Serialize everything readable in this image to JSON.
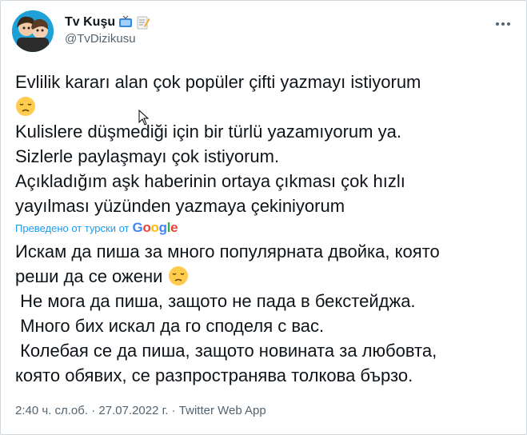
{
  "author": {
    "display_name": "Tv Kuşu",
    "handle": "@TvDizikusu"
  },
  "tweet": {
    "original_lines": [
      "Evlilik kararı alan çok popüler çifti yazmayı istiyorum",
      "Kulislere düşmediği için bir türlü yazamıyorum ya.",
      "Sizlerle paylaşmayı çok istiyorum.",
      "Açıkladığım aşk haberinin ortaya çıkması çok hızlı",
      "yayılması yüzünden yazmaya çekiniyorum"
    ],
    "translation_credit": "Преведено от турски от",
    "translation_provider": "Google",
    "translated_lines": [
      "Искам да пиша за много популярната двойка, която",
      "реши да се ожени",
      " Не мога да пиша, защото не пада в бекстейджа.",
      " Много бих искал да го споделя с вас.",
      " Колебая се да пиша, защото новината за любовта,",
      "която обявих, се разпространява толкова бързо."
    ]
  },
  "meta": {
    "time": "2:40 ч. сл.об.",
    "separator": "·",
    "date": "27.07.2022 г.",
    "source": "Twitter Web App"
  },
  "colors": {
    "link": "#1d9bf0",
    "secondary_text": "#536471",
    "border": "#cfd9de"
  },
  "icons": {
    "emoji_after_name": [
      "tv-icon",
      "memo-icon"
    ],
    "pensive_face": "pensive-face-icon",
    "more": "more-horizontal-icon"
  }
}
